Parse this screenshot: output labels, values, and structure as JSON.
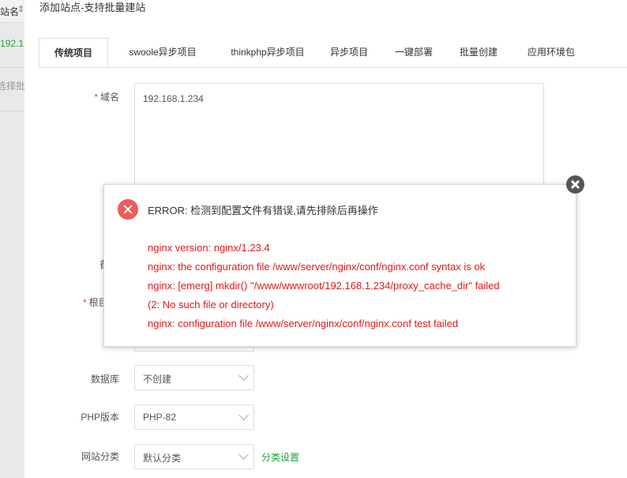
{
  "background": {
    "site_label": "站名",
    "arrow": "⇕",
    "ip_fragment": "192.1",
    "select_fragment": "选择批"
  },
  "dialog": {
    "title": "添加站点-支持批量建站",
    "tabs": [
      {
        "label": "传统项目",
        "active": true
      },
      {
        "label": "swoole异步项目"
      },
      {
        "label": "thinkphp异步项目"
      },
      {
        "label": "异步项目"
      },
      {
        "label": "一键部署"
      },
      {
        "label": "批量创建"
      },
      {
        "label": "应用环境包"
      }
    ],
    "form": {
      "domain": {
        "required_mark": "*",
        "label": "域名",
        "value": "192.168.1.234"
      },
      "note_partial": {
        "label": "备"
      },
      "root_partial": {
        "required_mark": "*",
        "label": "根目"
      },
      "database": {
        "label": "数据库",
        "value": "不创建"
      },
      "php_version": {
        "label": "PHP版本",
        "value": "PHP-82"
      },
      "site_category": {
        "label": "网站分类",
        "value": "默认分类",
        "link": "分类设置"
      }
    }
  },
  "error_popup": {
    "title": "ERROR: 检测到配置文件有错误,请先排除后再操作",
    "lines": [
      "nginx version: nginx/1.23.4",
      "nginx: the configuration file /www/server/nginx/conf/nginx.conf syntax is ok",
      "nginx: [emerg] mkdir() \"/www/wwwroot/192.168.1.234/proxy_cache_dir\" failed",
      "(2: No such file or directory)",
      "nginx: configuration file /www/server/nginx/conf/nginx.conf test failed"
    ],
    "colors": {
      "error_text": "#e01818",
      "icon": "#ef5b5b",
      "accent_green": "#20a53a"
    }
  }
}
